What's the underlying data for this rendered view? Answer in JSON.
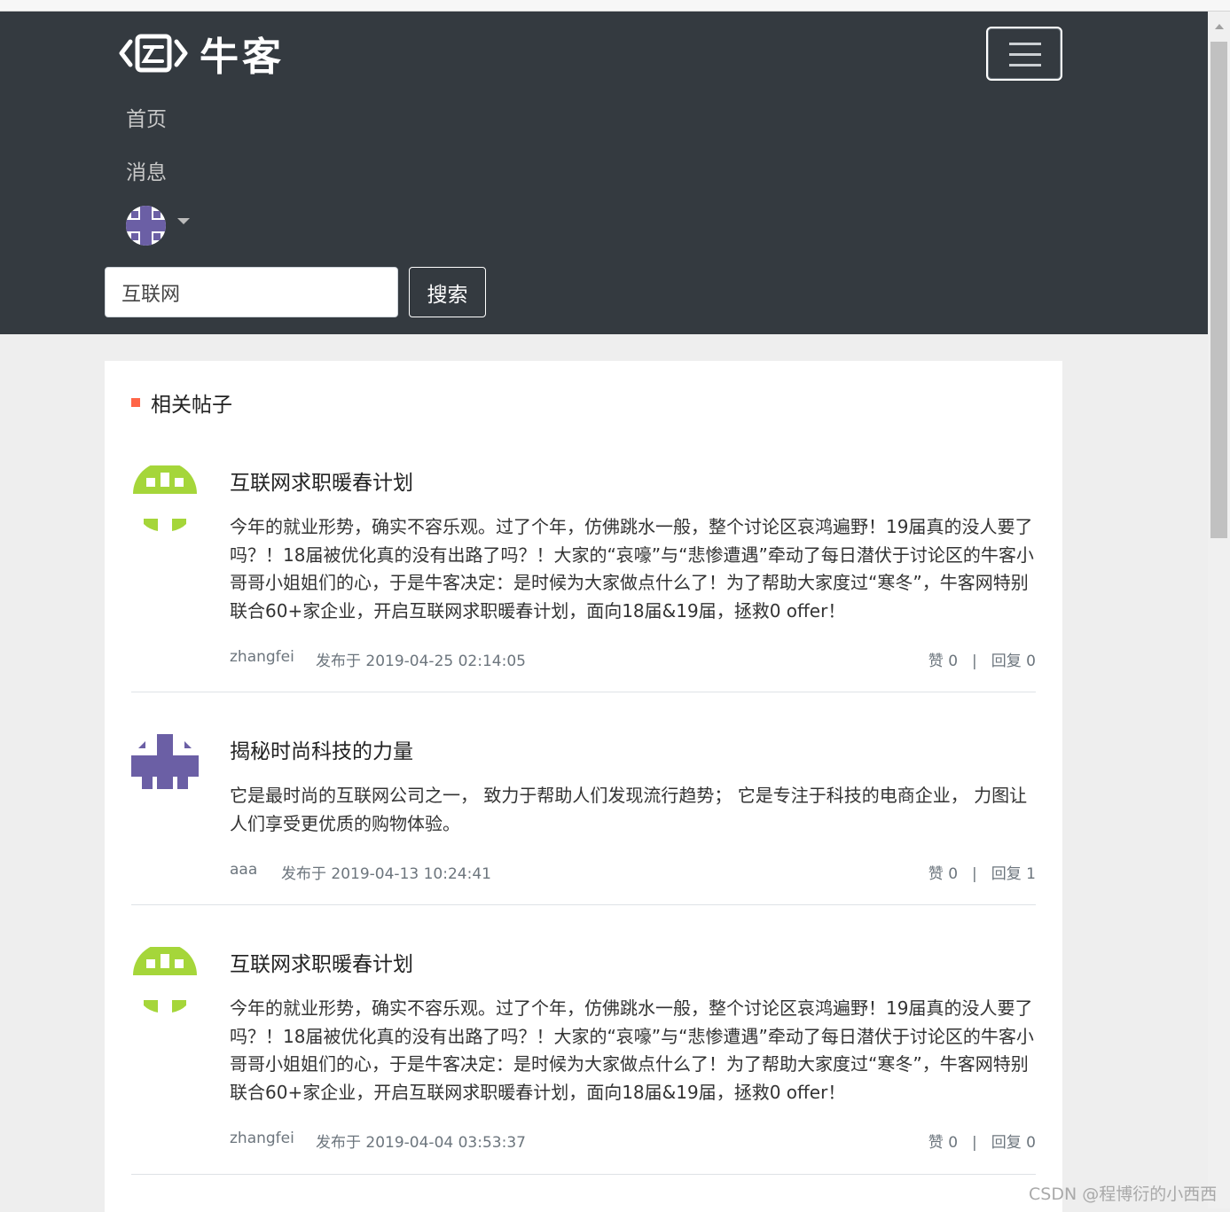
{
  "brand": {
    "name": "牛客",
    "logo_icon": "niuke-logo-icon"
  },
  "nav": {
    "items": [
      {
        "label": "首页"
      },
      {
        "label": "消息"
      }
    ],
    "menu_icon": "hamburger-icon"
  },
  "search": {
    "value": "互联网",
    "button_label": "搜索"
  },
  "section": {
    "title": "相关帖子"
  },
  "posts": [
    {
      "title": "互联网求职暖春计划",
      "body": "今年的就业形势，确实不容乐观。过了个年，仿佛跳水一般，整个讨论区哀鸿遍野！19届真的没人要了吗？！18届被优化真的没有出路了吗？！大家的“哀嚎”与“悲惨遭遇”牵动了每日潜伏于讨论区的牛客小哥哥小姐姐们的心，于是牛客决定：是时候为大家做点什么了！为了帮助大家度过“寒冬”，牛客网特别联合60+家企业，开启互联网求职暖春计划，面向18届&19届，拯救0 offer！",
      "author": "zhangfei",
      "date": "发布于 2019-04-25 02:14:05",
      "likes": "赞 0",
      "replies": "回复 0",
      "avatar_color": "#a5d63a"
    },
    {
      "title": "揭秘时尚科技的力量",
      "body": "它是最时尚的互联网公司之一， 致力于帮助人们发现流行趋势； 它是专注于科技的电商企业， 力图让人们享受更优质的购物体验。",
      "author": "aaa",
      "date": "发布于 2019-04-13 10:24:41",
      "likes": "赞 0",
      "replies": "回复 1",
      "avatar_color": "#6b5fa5"
    },
    {
      "title": "互联网求职暖春计划",
      "body": "今年的就业形势，确实不容乐观。过了个年，仿佛跳水一般，整个讨论区哀鸿遍野！19届真的没人要了吗？！18届被优化真的没有出路了吗？！大家的“哀嚎”与“悲惨遭遇”牵动了每日潜伏于讨论区的牛客小哥哥小姐姐们的心，于是牛客决定：是时候为大家做点什么了！为了帮助大家度过“寒冬”，牛客网特别联合60+家企业，开启互联网求职暖春计划，面向18届&19届，拯救0 offer！",
      "author": "zhangfei",
      "date": "发布于 2019-04-04 03:53:37",
      "likes": "赞 0",
      "replies": "回复 0",
      "avatar_color": "#a5d63a"
    }
  ],
  "meta_separator": "|",
  "watermark": "CSDN @程博衍的小西西"
}
